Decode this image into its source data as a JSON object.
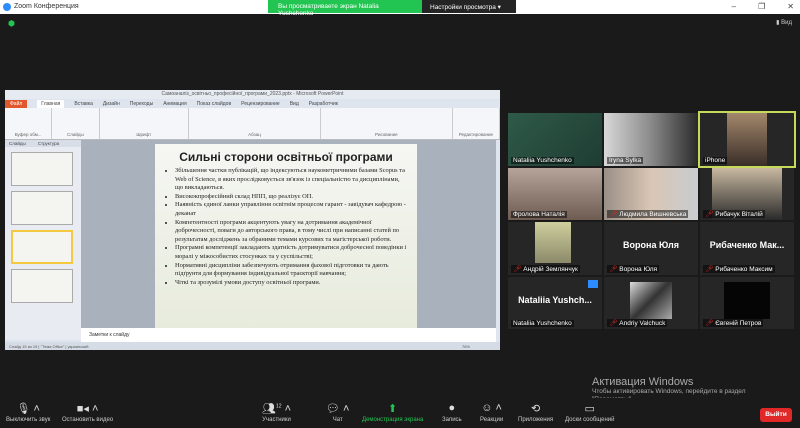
{
  "window": {
    "title": "Zoom Конференция",
    "banner": "Вы просматриваете экран Natalia Yushchenko",
    "view_options": "Настройки просмотра ▾",
    "view": "Вид"
  },
  "ppt": {
    "title": "Самоаналіз_освітньо_професійної_програми_2023.pptx - Microsoft PowerPoint",
    "tabs": [
      "Файл",
      "Главная",
      "Вставка",
      "Дизайн",
      "Переходы",
      "Анимация",
      "Показ слайдов",
      "Рецензирование",
      "Вид",
      "Разработчик"
    ],
    "groups": [
      "Буфер обм...",
      "Слайды",
      "Шрифт",
      "Абзац",
      "Рисование",
      "Редактирование"
    ],
    "panel_tabs": [
      "Слайды",
      "Структура"
    ],
    "slide": {
      "title": "Сильні сторони освітньої програми",
      "bullets": [
        "Збільшення частки публікацій, що індексуються наукометричними базами Scopus та Web of Science, в яких прослідковується зв'язок із спеціальністю та дисциплінами, що викладаються.",
        "Висококпрофесійний склад НПП, що реалізує ОП.",
        "Наявність єдиної ланки управління освітнім процесом гарант - завідувач кафедрою - деканат",
        "Компетентності програми акцентують увагу на дотримання академічної доброчесності, поваги до авторського права, в тому числі при написанні статей по результатам досліджень за обраними темами курсових та магістерської роботи.",
        "Програмні компетенції закладають здатність дотримуватися доброчесної поведінки і моралі у міжособистих стосунках та у суспільстві;",
        "Нормативні дисципліни забезпечують отримання фахової підготовки та дають підґрунтя для формування індивідуальної траєкторії навчання;",
        "Чіткі та зрозумілі умови доступу освітньої програми."
      ]
    },
    "notes": "Заметки к слайду",
    "status": "Слайд 15 из 19 | \"Тема Office\" | украинский",
    "zoom": "76%"
  },
  "participants": [
    {
      "name": "Nataliia Yushchenko",
      "muted": false
    },
    {
      "name": "Iryna Sylka",
      "muted": false
    },
    {
      "name": "iPhone",
      "muted": false
    },
    {
      "name": "Фролова Наталія",
      "muted": false
    },
    {
      "name": "Людмила Вишневська",
      "muted": true
    },
    {
      "name": "Рибачук Віталій",
      "muted": true
    },
    {
      "name": "Андрій Землянчук",
      "muted": true
    },
    {
      "name": "Ворона Юля",
      "muted": true,
      "big": "Ворона Юля"
    },
    {
      "name": "Рибаченко Максим",
      "muted": true,
      "big": "Рибаченко Мак..."
    },
    {
      "name": "Nataliia Yushchenko",
      "muted": false,
      "big": "Nataliia Yushch..."
    },
    {
      "name": "Andriy Valchuck",
      "muted": true
    },
    {
      "name": "Євгеній Петров",
      "muted": true
    }
  ],
  "activation": {
    "title": "Активация Windows",
    "text": "Чтобы активировать Windows, перейдите в раздел \"Параметры\"."
  },
  "toolbar": {
    "mute": "Выключить звук",
    "video": "Остановить видео",
    "participants": "Участники",
    "participants_count": "12",
    "chat": "Чат",
    "share": "Демонстрация экрана",
    "record": "Запись",
    "reactions": "Реакции",
    "apps": "Приложения",
    "whiteboards": "Доски сообщений",
    "leave": "Выйти"
  }
}
